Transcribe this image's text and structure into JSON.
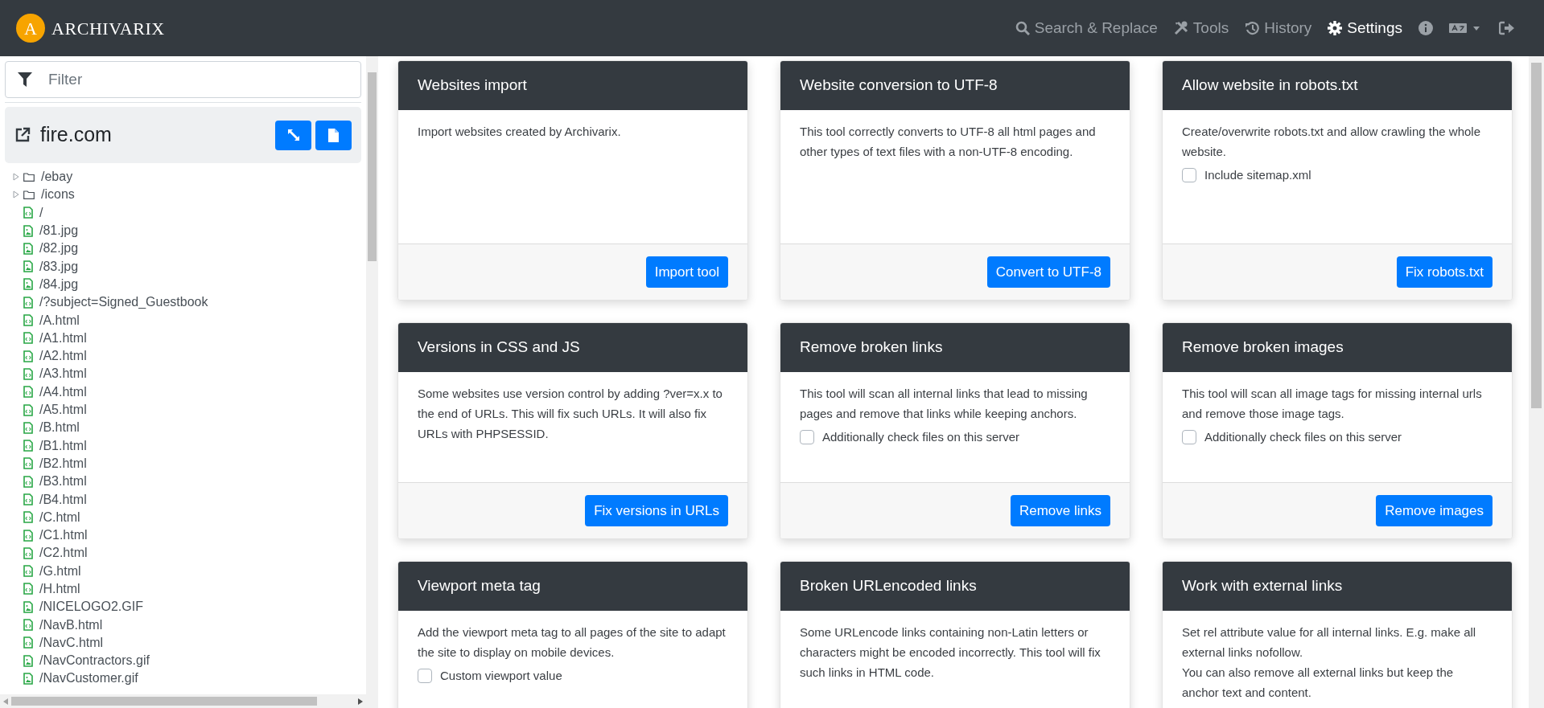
{
  "header": {
    "brand": "ARCHIVARIX",
    "logo_letter": "A",
    "nav": [
      {
        "label": "Search & Replace",
        "selected": false
      },
      {
        "label": "Tools",
        "selected": false
      },
      {
        "label": "History",
        "selected": false
      },
      {
        "label": "Settings",
        "selected": true
      }
    ]
  },
  "sidebar": {
    "filter": {
      "placeholder": "Filter"
    },
    "domain": "fire.com",
    "tree": [
      {
        "label": "/ebay",
        "kind": "folder",
        "expanded": false
      },
      {
        "label": "/icons",
        "kind": "folder",
        "expanded": false
      },
      {
        "label": "/",
        "kind": "html"
      },
      {
        "label": "/81.jpg",
        "kind": "image"
      },
      {
        "label": "/82.jpg",
        "kind": "image"
      },
      {
        "label": "/83.jpg",
        "kind": "image"
      },
      {
        "label": "/84.jpg",
        "kind": "image"
      },
      {
        "label": "/?subject=Signed_Guestbook",
        "kind": "html"
      },
      {
        "label": "/A.html",
        "kind": "html"
      },
      {
        "label": "/A1.html",
        "kind": "html"
      },
      {
        "label": "/A2.html",
        "kind": "html"
      },
      {
        "label": "/A3.html",
        "kind": "html"
      },
      {
        "label": "/A4.html",
        "kind": "html"
      },
      {
        "label": "/A5.html",
        "kind": "html"
      },
      {
        "label": "/B.html",
        "kind": "html"
      },
      {
        "label": "/B1.html",
        "kind": "html"
      },
      {
        "label": "/B2.html",
        "kind": "html"
      },
      {
        "label": "/B3.html",
        "kind": "html"
      },
      {
        "label": "/B4.html",
        "kind": "html"
      },
      {
        "label": "/C.html",
        "kind": "html"
      },
      {
        "label": "/C1.html",
        "kind": "html"
      },
      {
        "label": "/C2.html",
        "kind": "html"
      },
      {
        "label": "/G.html",
        "kind": "html"
      },
      {
        "label": "/H.html",
        "kind": "html"
      },
      {
        "label": "/NICELOGO2.GIF",
        "kind": "image"
      },
      {
        "label": "/NavB.html",
        "kind": "html"
      },
      {
        "label": "/NavC.html",
        "kind": "html"
      },
      {
        "label": "/NavContractors.gif",
        "kind": "image"
      },
      {
        "label": "/NavCustomer.gif",
        "kind": "image"
      }
    ]
  },
  "cards": [
    {
      "title": "Websites import",
      "description": [
        "Import websites created by Archivarix."
      ],
      "button": "Import tool"
    },
    {
      "title": "Website conversion to UTF-8",
      "description": [
        "This tool correctly converts to UTF-8 all html pages and other types of text files with a non-UTF-8 encoding."
      ],
      "button": "Convert to UTF-8"
    },
    {
      "title": "Allow website in robots.txt",
      "description": [
        "Create/overwrite robots.txt and allow crawling the whole website."
      ],
      "checkbox": {
        "label": "Include sitemap.xml",
        "checked": false
      },
      "button": "Fix robots.txt"
    },
    {
      "title": "Versions in CSS and JS",
      "description": [
        "Some websites use version control by adding ?ver=x.x to the end of URLs. This will fix such URLs. It will also fix URLs with PHPSESSID."
      ],
      "button": "Fix versions in URLs"
    },
    {
      "title": "Remove broken links",
      "description": [
        "This tool will scan all internal links that lead to missing pages and remove that links while keeping anchors."
      ],
      "checkbox": {
        "label": "Additionally check files on this server",
        "checked": false
      },
      "button": "Remove links"
    },
    {
      "title": "Remove broken images",
      "description": [
        "This tool will scan all image tags for missing internal urls and remove those image tags."
      ],
      "checkbox": {
        "label": "Additionally check files on this server",
        "checked": false
      },
      "button": "Remove images"
    },
    {
      "title": "Viewport meta tag",
      "description": [
        "Add the viewport meta tag to all pages of the site to adapt the site to display on mobile devices."
      ],
      "checkbox": {
        "label": "Custom viewport value",
        "checked": false
      }
    },
    {
      "title": "Broken URLencoded links",
      "description": [
        "Some URLencode links containing non-Latin letters or characters might be encoded incorrectly. This tool will fix such links in HTML code."
      ]
    },
    {
      "title": "Work with external links",
      "description": [
        "Set rel attribute value for all internal links. E.g. make all external links nofollow.",
        "You can also remove all external links but keep the anchor text and content."
      ]
    }
  ]
}
